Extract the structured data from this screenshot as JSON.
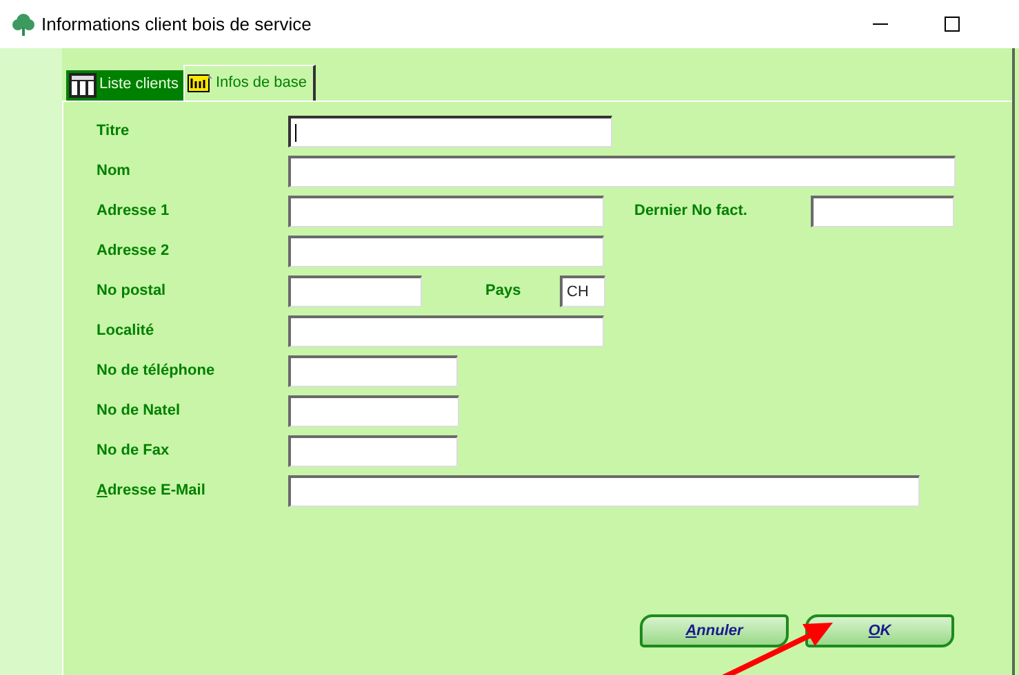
{
  "window": {
    "title": "Informations client bois de service"
  },
  "tabs": [
    {
      "label": "Liste clients",
      "selected": false,
      "kind": "list"
    },
    {
      "label": "Infos de base",
      "selected": true,
      "kind": "info"
    }
  ],
  "rows": [
    {
      "label": "Titre",
      "focused": true
    },
    {
      "label": "Nom",
      "focused": false
    },
    {
      "label": "Adresse 1",
      "focused": false,
      "extra": {
        "label": "Dernier No fact.",
        "kind": "far"
      }
    },
    {
      "label": "Adresse 2",
      "focused": false
    },
    {
      "label": "No postal",
      "focused": false,
      "extra": {
        "label": "Pays",
        "kind": "near",
        "value": "CH"
      }
    },
    {
      "label": "Localité",
      "focused": false
    },
    {
      "label": "No de téléphone",
      "focused": false
    },
    {
      "label": "No de Natel",
      "focused": false
    },
    {
      "label": "No de Fax",
      "focused": false
    },
    {
      "label": "Adresse E-Mail",
      "focused": false,
      "mnemonic": true
    }
  ],
  "buttons": [
    {
      "label": "Annuler",
      "mnemonic": true
    },
    {
      "label": "OK",
      "mnemonic": true
    }
  ]
}
